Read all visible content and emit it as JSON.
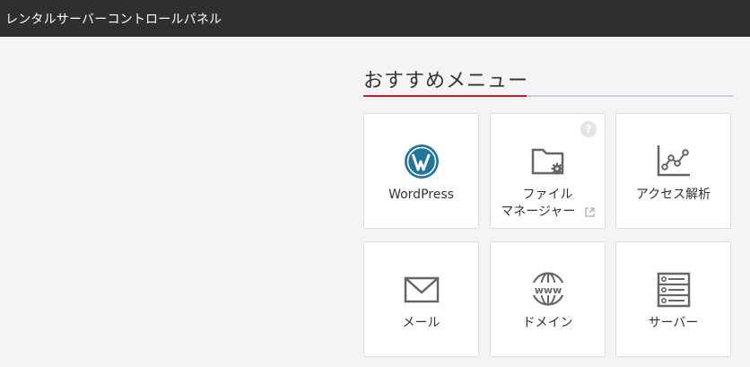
{
  "header": {
    "title": "レンタルサーバーコントロールパネル"
  },
  "section": {
    "title": "おすすめメニュー"
  },
  "colors": {
    "accent": "#c01f2c",
    "topbar": "#2f2f2f",
    "icon": "#666666",
    "wordpress": "#21759b"
  },
  "menu": [
    {
      "label": "WordPress",
      "icon": "wordpress-icon"
    },
    {
      "label_line1": "ファイル",
      "label_line2": "マネージャー",
      "icon": "folder-gear-icon",
      "help": "?"
    },
    {
      "label": "アクセス解析",
      "icon": "line-chart-icon"
    },
    {
      "label": "メール",
      "icon": "mail-icon"
    },
    {
      "label": "ドメイン",
      "icon": "www-globe-icon"
    },
    {
      "label": "サーバー",
      "icon": "server-icon"
    }
  ]
}
